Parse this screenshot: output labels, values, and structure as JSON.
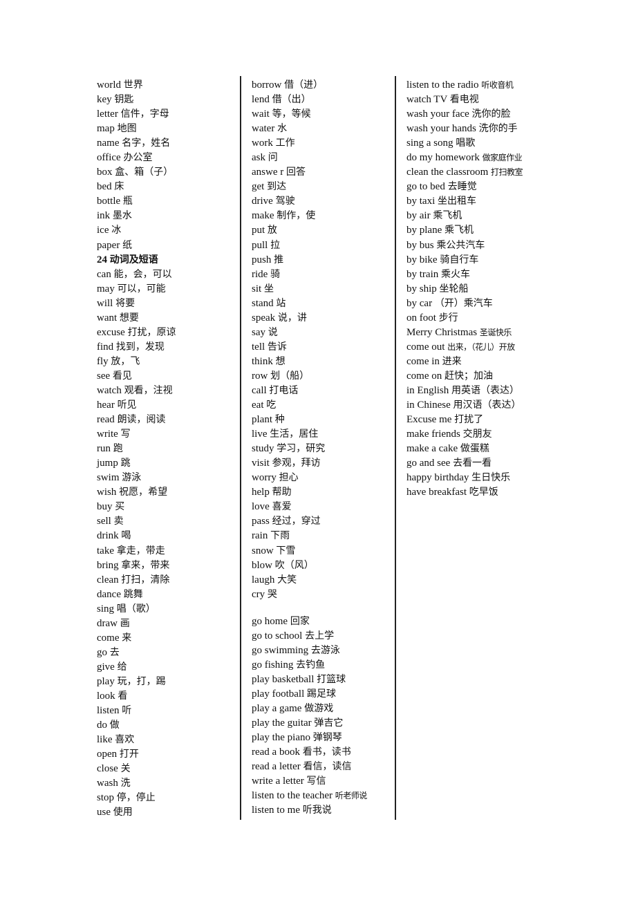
{
  "document": {
    "columns": [
      {
        "name": "left",
        "entries": [
          {
            "en": "world",
            "zh": "世界"
          },
          {
            "en": "key",
            "zh": "钥匙"
          },
          {
            "en": "letter",
            "zh": "信件，字母"
          },
          {
            "en": "map",
            "zh": "地图"
          },
          {
            "en": "name",
            "zh": "名字，姓名"
          },
          {
            "en": "office",
            "zh": "办公室"
          },
          {
            "en": "box",
            "zh": "盒、箱（子）"
          },
          {
            "en": "bed",
            "zh": "床"
          },
          {
            "en": "bottle",
            "zh": "瓶"
          },
          {
            "en": "ink",
            "zh": "墨水"
          },
          {
            "en": "ice",
            "zh": "冰"
          },
          {
            "en": "paper",
            "zh": "纸"
          },
          {
            "en": "24",
            "zh": " 动词及短语",
            "heading": true
          },
          {
            "en": "can",
            "zh": " 能，会，可以"
          },
          {
            "en": "may",
            "zh": "可以，可能"
          },
          {
            "en": "will",
            "zh": "将要"
          },
          {
            "en": "want",
            "zh": "想要"
          },
          {
            "en": "excuse",
            "zh": "打扰，原谅"
          },
          {
            "en": "find",
            "zh": "找到，发现"
          },
          {
            "en": "fly",
            "zh": "放，飞"
          },
          {
            "en": "see",
            "zh": "看见"
          },
          {
            "en": "watch",
            "zh": "观看，注视"
          },
          {
            "en": "hear",
            "zh": "听见"
          },
          {
            "en": "read",
            "zh": "朗读，阅读"
          },
          {
            "en": "write",
            "zh": "写"
          },
          {
            "en": "run",
            "zh": "跑"
          },
          {
            "en": "jump",
            "zh": "跳"
          },
          {
            "en": "swim",
            "zh": "游泳"
          },
          {
            "en": "wish",
            "zh": "祝愿，希望"
          },
          {
            "en": "buy",
            "zh": "买"
          },
          {
            "en": "sell",
            "zh": "卖"
          },
          {
            "en": "drink",
            "zh": "喝"
          },
          {
            "en": "take",
            "zh": "拿走，带走"
          },
          {
            "en": "bring",
            "zh": " 拿来，带来"
          },
          {
            "en": "clean",
            "zh": "打扫，清除"
          },
          {
            "en": "dance",
            "zh": "跳舞"
          },
          {
            "en": "sing",
            "zh": "唱（歌）"
          },
          {
            "en": "draw",
            "zh": "画"
          },
          {
            "en": "come",
            "zh": "来"
          },
          {
            "en": "go",
            "zh": " 去"
          },
          {
            "en": "give",
            "zh": " 给"
          },
          {
            "en": "play",
            "zh": "玩，打，踢"
          },
          {
            "en": "look",
            "zh": "看"
          },
          {
            "en": "listen",
            "zh": "听"
          },
          {
            "en": "do",
            "zh": "做"
          },
          {
            "en": "like",
            "zh": "喜欢"
          },
          {
            "en": "open",
            "zh": "打开"
          },
          {
            "en": "close",
            "zh": "关"
          },
          {
            "en": "wash",
            "zh": "洗"
          },
          {
            "en": "stop",
            "zh": "停，停止"
          },
          {
            "en": "use",
            "zh": "使用"
          }
        ]
      },
      {
        "name": "middle",
        "entries": [
          {
            "en": "borrow",
            "zh": "借（进）"
          },
          {
            "en": "lend",
            "zh": "借（出）"
          },
          {
            "en": "wait",
            "zh": "等，等候"
          },
          {
            "en": "water",
            "zh": "水"
          },
          {
            "en": "work",
            "zh": "工作"
          },
          {
            "en": "ask",
            "zh": "问"
          },
          {
            "en": "answe r",
            "zh": "回答"
          },
          {
            "en": "get",
            "zh": "到达"
          },
          {
            "en": "drive",
            "zh": "驾驶"
          },
          {
            "en": "make",
            "zh": "制作，使"
          },
          {
            "en": "put",
            "zh": "放"
          },
          {
            "en": "pull",
            "zh": "拉"
          },
          {
            "en": "push",
            "zh": "推"
          },
          {
            "en": "ride",
            "zh": "骑"
          },
          {
            "en": "sit",
            "zh": "坐"
          },
          {
            "en": "stand",
            "zh": "站"
          },
          {
            "en": "speak",
            "zh": "说，讲"
          },
          {
            "en": "say",
            "zh": "说"
          },
          {
            "en": "tell",
            "zh": "告诉"
          },
          {
            "en": "think",
            "zh": "想"
          },
          {
            "en": "row",
            "zh": "划（船）"
          },
          {
            "en": "call",
            "zh": "打电话"
          },
          {
            "en": "eat",
            "zh": "吃"
          },
          {
            "en": "plant",
            "zh": "种"
          },
          {
            "en": "live",
            "zh": "生活，居住"
          },
          {
            "en": "study",
            "zh": "学习，研究"
          },
          {
            "en": "visit",
            "zh": "参观，拜访"
          },
          {
            "en": "worry",
            "zh": "担心"
          },
          {
            "en": "help",
            "zh": "帮助"
          },
          {
            "en": "love",
            "zh": "喜爱"
          },
          {
            "en": "pass",
            "zh": "经过，穿过"
          },
          {
            "en": "rain",
            "zh": "下雨"
          },
          {
            "en": "snow",
            "zh": "下雪"
          },
          {
            "en": "blow",
            "zh": "吹（风）"
          },
          {
            "en": "laugh",
            "zh": "大笑"
          },
          {
            "en": "cry",
            "zh": "哭"
          }
        ],
        "phrases": [
          {
            "en": "go home",
            "zh": "回家"
          },
          {
            "en": "go to school",
            "zh": "去上学"
          },
          {
            "en": "go swimming",
            "zh": "去游泳"
          },
          {
            "en": "go fishing",
            "zh": "去钓鱼"
          },
          {
            "en": "play basketball",
            "zh": "打篮球"
          },
          {
            "en": "play football",
            "zh": "踢足球"
          },
          {
            "en": "play a game",
            "zh": "做游戏"
          },
          {
            "en": "play the guitar",
            "zh": "弹吉它"
          },
          {
            "en": "play the piano",
            "zh": "弹钢琴"
          },
          {
            "en": "read a book",
            "zh": "看书，读书"
          },
          {
            "en": "read a letter",
            "zh": "看信，读信"
          },
          {
            "en": "write a letter",
            "zh": "写信"
          },
          {
            "en": "listen to the teacher",
            "zh": "听老师说",
            "small": true
          },
          {
            "en": "listen to me",
            "zh": "听我说"
          }
        ]
      },
      {
        "name": "right",
        "entries": [
          {
            "en": "listen to the radio",
            "zh": "听收音机",
            "small": true
          },
          {
            "en": "watch TV",
            "zh": "看电视"
          },
          {
            "en": "wash your face",
            "zh": "洗你的脸"
          },
          {
            "en": "wash your hands",
            "zh": "洗你的手"
          },
          {
            "en": "sing a song",
            "zh": "唱歌"
          },
          {
            "en": "do my homework",
            "zh": "做家庭作业",
            "small": true
          },
          {
            "en": "clean the classroom",
            "zh": "打扫教室",
            "small": true
          },
          {
            "en": "go to bed",
            "zh": "去睡觉"
          },
          {
            "en": "by taxi",
            "zh": "坐出租车"
          },
          {
            "en": "by air",
            "zh": "乘飞机"
          },
          {
            "en": "by plane",
            "zh": "乘飞机"
          },
          {
            "en": "by bus",
            "zh": "乘公共汽车"
          },
          {
            "en": "by bike",
            "zh": "骑自行车"
          },
          {
            "en": "by train",
            "zh": "乘火车"
          },
          {
            "en": "by ship",
            "zh": "坐轮船"
          },
          {
            "en": "by car",
            "zh": "（开）乘汽车"
          },
          {
            "en": "on foot",
            "zh": "步行"
          },
          {
            "en": "Merry Christmas",
            "zh": "圣诞快乐",
            "small": true
          },
          {
            "en": "come out",
            "zh": "出来，（花儿）开放",
            "small": true
          },
          {
            "en": "come in",
            "zh": "进来"
          },
          {
            "en": "come on",
            "zh": "赶快；加油"
          },
          {
            "en": "in English",
            "zh": "用英语（表达）"
          },
          {
            "en": "in Chinese",
            "zh": "用汉语（表达）"
          },
          {
            "en": "Excuse me",
            "zh": "打扰了"
          },
          {
            "en": "make friends",
            "zh": "交朋友"
          },
          {
            "en": "make a cake",
            "zh": "做蛋糕"
          },
          {
            "en": "go and see",
            "zh": "去看一看"
          },
          {
            "en": "happy birthday",
            "zh": "生日快乐"
          },
          {
            "en": "have breakfast",
            "zh": "吃早饭"
          }
        ]
      }
    ]
  }
}
